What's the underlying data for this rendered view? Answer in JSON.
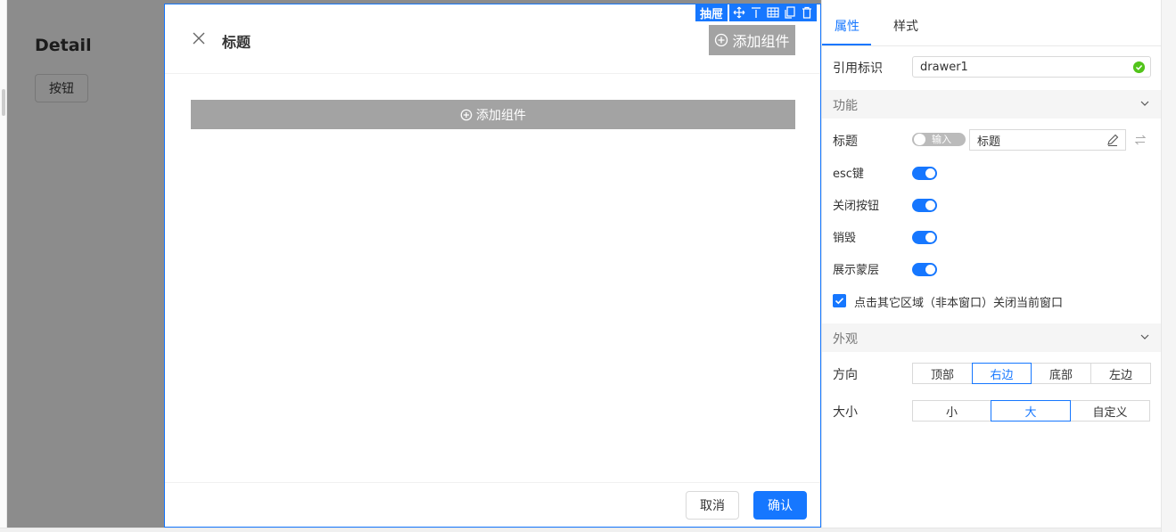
{
  "page": {
    "title": "Detail",
    "button_label": "按钮"
  },
  "drawer": {
    "title": "标题",
    "header_add_label": "添加组件",
    "body_add_label": "添加组件",
    "cancel_label": "取消",
    "confirm_label": "确认"
  },
  "toolbar": {
    "component_label": "抽屉",
    "icons": [
      "move-icon",
      "align-top-icon",
      "table-icon",
      "copy-icon",
      "delete-icon"
    ]
  },
  "panel": {
    "tabs": [
      {
        "label": "属性",
        "active": true
      },
      {
        "label": "样式",
        "active": false
      }
    ],
    "ref": {
      "label": "引用标识",
      "value": "drawer1"
    },
    "func_section": {
      "title": "功能"
    },
    "title_row": {
      "label": "标题",
      "mode_label": "输入",
      "value": "标题"
    },
    "switches": [
      {
        "label": "esc键",
        "on": true
      },
      {
        "label": "关闭按钮",
        "on": true
      },
      {
        "label": "销毁",
        "on": true
      },
      {
        "label": "展示蒙层",
        "on": true
      }
    ],
    "mask_close": {
      "label": "点击其它区域（非本窗口）关闭当前窗口",
      "checked": true
    },
    "appearance_section": {
      "title": "外观"
    },
    "direction": {
      "label": "方向",
      "options": [
        "顶部",
        "右边",
        "底部",
        "左边"
      ],
      "selected": "右边"
    },
    "size": {
      "label": "大小",
      "options": [
        "小",
        "大",
        "自定义"
      ],
      "selected": "大"
    }
  },
  "colors": {
    "accent": "#1677ff",
    "success": "#52c41a",
    "placeholder_bg": "#a3a3a3"
  }
}
